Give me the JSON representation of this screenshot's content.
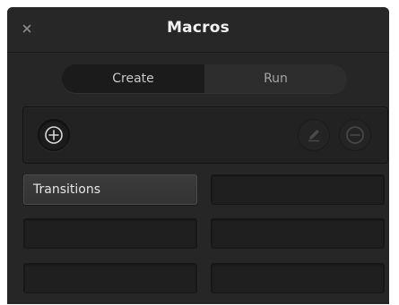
{
  "window": {
    "title": "Macros",
    "close_icon": "close-icon"
  },
  "tabs": [
    {
      "label": "Create",
      "active": true
    },
    {
      "label": "Run",
      "active": false
    }
  ],
  "toolbar": {
    "add_icon": "plus-circle-icon",
    "edit_icon": "pencil-icon",
    "remove_icon": "minus-circle-icon"
  },
  "macros": [
    {
      "label": "Transitions"
    },
    {
      "label": ""
    },
    {
      "label": ""
    },
    {
      "label": ""
    },
    {
      "label": ""
    },
    {
      "label": ""
    }
  ],
  "colors": {
    "panel_bg": "#262626",
    "text": "#e6e6e6",
    "icon_active": "#d8d8d8",
    "icon_disabled": "#4a4a4a"
  }
}
